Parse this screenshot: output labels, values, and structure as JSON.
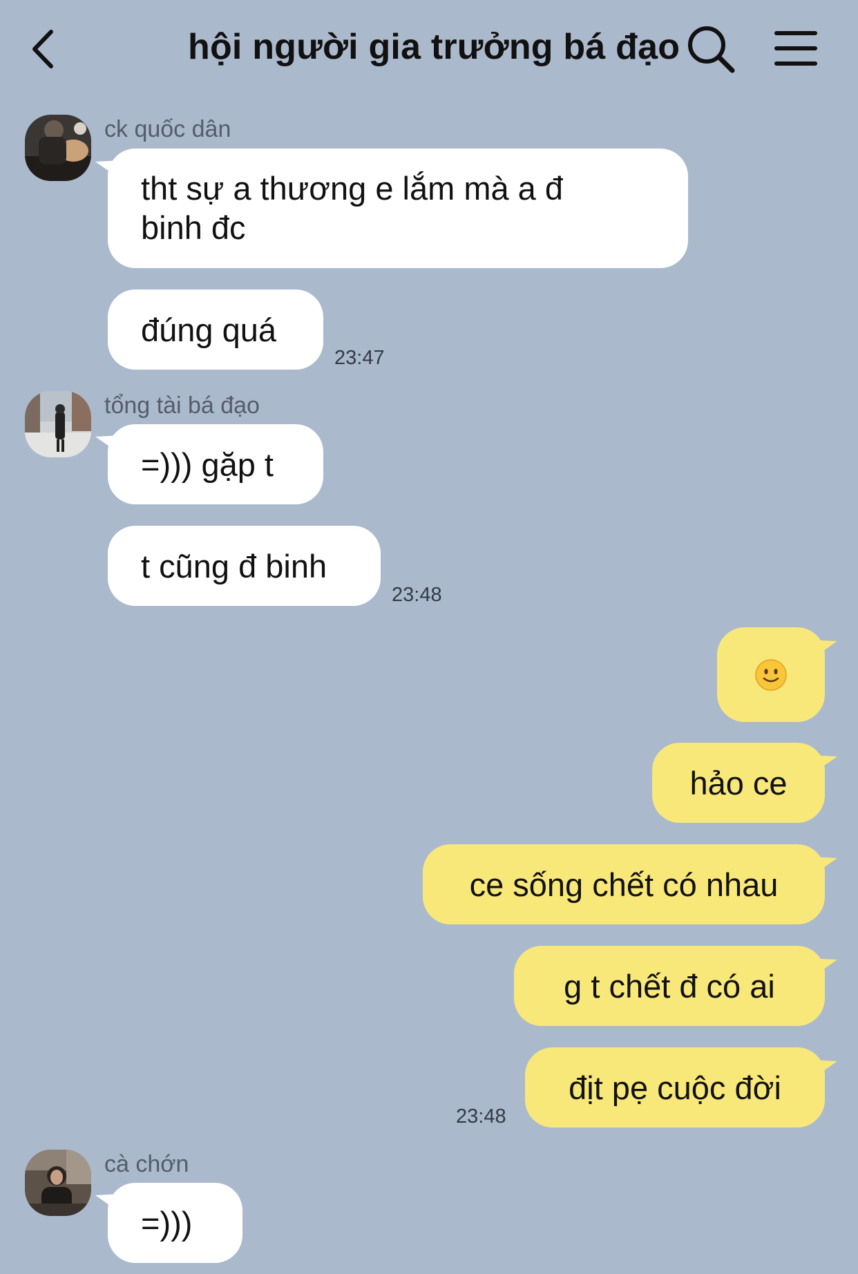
{
  "header": {
    "title": "hội người gia trưởng bá đạo"
  },
  "messages": [
    {
      "sender": "ck quốc dân",
      "lines": [
        "tht sự a thương e lắm mà a đ",
        "binh đc"
      ]
    },
    {
      "text": "đúng quá",
      "time": "23:47"
    },
    {
      "sender": "tổng tài bá đạo",
      "text": "=))) gặp t"
    },
    {
      "text": "t cũng đ binh",
      "time": "23:48"
    },
    {
      "emoji": "slightly-smiling-face-icon"
    },
    {
      "text": "hảo ce"
    },
    {
      "text": "ce sống chết có nhau"
    },
    {
      "text": "g t chết đ có ai"
    },
    {
      "text": "địt pẹ cuộc đời",
      "time": "23:48"
    },
    {
      "sender": "cà chớn",
      "text": "=)))"
    }
  ],
  "colors": {
    "background": "#abb9cd",
    "incoming_bubble": "#ffffff",
    "outgoing_bubble": "#f8e87a"
  }
}
